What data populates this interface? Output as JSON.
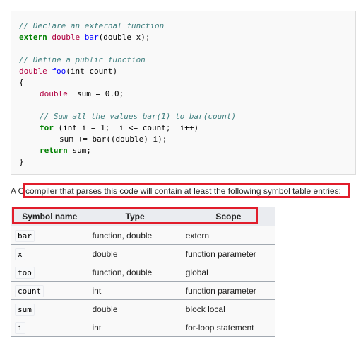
{
  "code": {
    "line1": "// Declare an external function",
    "line2_kw": "extern",
    "line2_type": "double",
    "line2_fn": "bar",
    "line2_params": "(double x);",
    "line3": "// Define a public function",
    "line4_type": "double",
    "line4_fn": "foo",
    "line4_params": "(int count)",
    "line5": "{",
    "line6_type": "double",
    "line6_rest": "sum = 0.0;",
    "line7": "// Sum all the values bar(1) to bar(count)",
    "line8_kw": "for",
    "line8_rest": "(int i = 1;  i <= count;  i++)",
    "line9": "sum += bar((double) i);",
    "line10_kw": "return",
    "line10_rest": "sum;",
    "line11": "}"
  },
  "caption": {
    "prefix": "A C",
    "text": "compiler that parses this code will contain at least the following symbol table entries:"
  },
  "table": {
    "headers": [
      "Symbol name",
      "Type",
      "Scope"
    ],
    "rows": [
      {
        "symbol": "bar",
        "type": "function, double",
        "scope": "extern"
      },
      {
        "symbol": "x",
        "type": "double",
        "scope": "function parameter"
      },
      {
        "symbol": "foo",
        "type": "function, double",
        "scope": "global"
      },
      {
        "symbol": "count",
        "type": "int",
        "scope": "function parameter"
      },
      {
        "symbol": "sum",
        "type": "double",
        "scope": "block local"
      },
      {
        "symbol": "i",
        "type": "int",
        "scope": "for-loop statement"
      }
    ]
  },
  "colors": {
    "highlight": "#e11d2b",
    "comment": "#408080",
    "keyword": "#008000",
    "type": "#b00040",
    "function": "#0000ff"
  }
}
